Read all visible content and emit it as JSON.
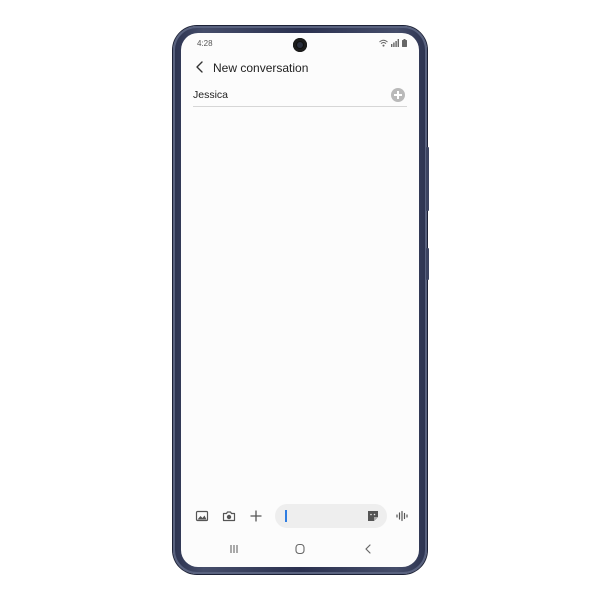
{
  "status_bar": {
    "time": "4:28",
    "icons": [
      "wifi-icon",
      "signal-icon",
      "battery-icon"
    ]
  },
  "header": {
    "title": "New conversation",
    "back_icon": "chevron-left-icon"
  },
  "recipient": {
    "value": "Jessica",
    "add_icon": "add-circle-icon"
  },
  "composer": {
    "left_icons": [
      "gallery-icon",
      "camera-icon",
      "plus-icon"
    ],
    "message_value": "",
    "sticker_icon": "sticker-icon",
    "voice_icon": "voice-icon"
  },
  "nav_bar": {
    "buttons": [
      "recents-icon",
      "home-icon",
      "back-icon"
    ]
  },
  "colors": {
    "phone_frame": "#2c3350",
    "screen": "#fcfcfc",
    "caret": "#2f7de1",
    "field": "#eeeeee"
  }
}
